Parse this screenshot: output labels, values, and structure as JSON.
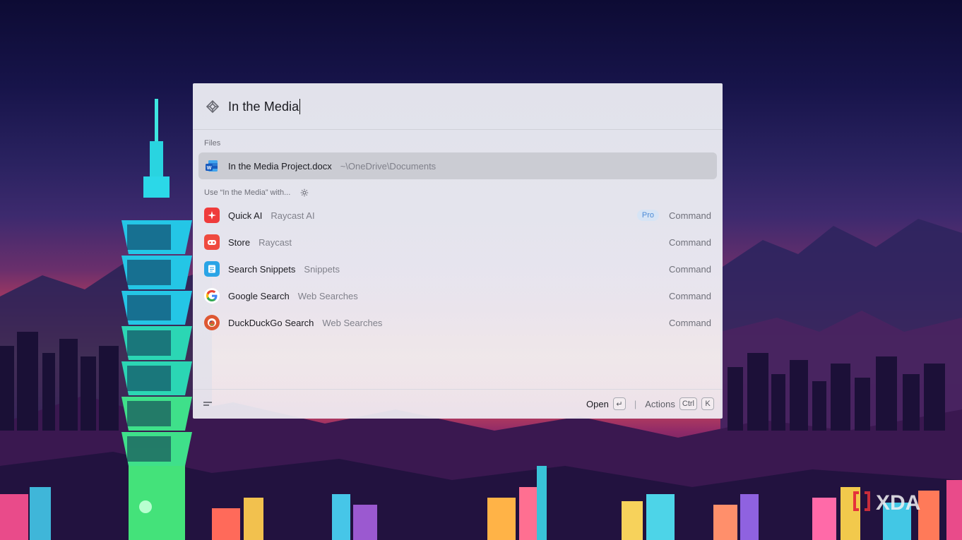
{
  "search": {
    "query": "In the Media"
  },
  "sections": {
    "files": "Files",
    "use_with": "Use “In the Media” with..."
  },
  "files": [
    {
      "title": "In the Media Project.docx",
      "subtitle": "~\\OneDrive\\Documents",
      "icon": "word-icon"
    }
  ],
  "commands": [
    {
      "title": "Quick AI",
      "subtitle": "Raycast AI",
      "badge": "Pro",
      "kind": "Command",
      "icon": "quick-ai-icon",
      "color": "#ef3b3b"
    },
    {
      "title": "Store",
      "subtitle": "Raycast",
      "kind": "Command",
      "icon": "store-icon",
      "color": "#ef4a3f"
    },
    {
      "title": "Search Snippets",
      "subtitle": "Snippets",
      "kind": "Command",
      "icon": "snippets-icon",
      "color": "#2aa4e6"
    },
    {
      "title": "Google Search",
      "subtitle": "Web Searches",
      "kind": "Command",
      "icon": "google-icon",
      "color": "#4285f4"
    },
    {
      "title": "DuckDuckGo Search",
      "subtitle": "Web Searches",
      "kind": "Command",
      "icon": "duckduckgo-icon",
      "color": "#de5833"
    }
  ],
  "footer": {
    "open_label": "Open",
    "open_key": "↵",
    "actions_label": "Actions",
    "actions_keys": [
      "Ctrl",
      "K"
    ]
  },
  "watermark": "XDA"
}
